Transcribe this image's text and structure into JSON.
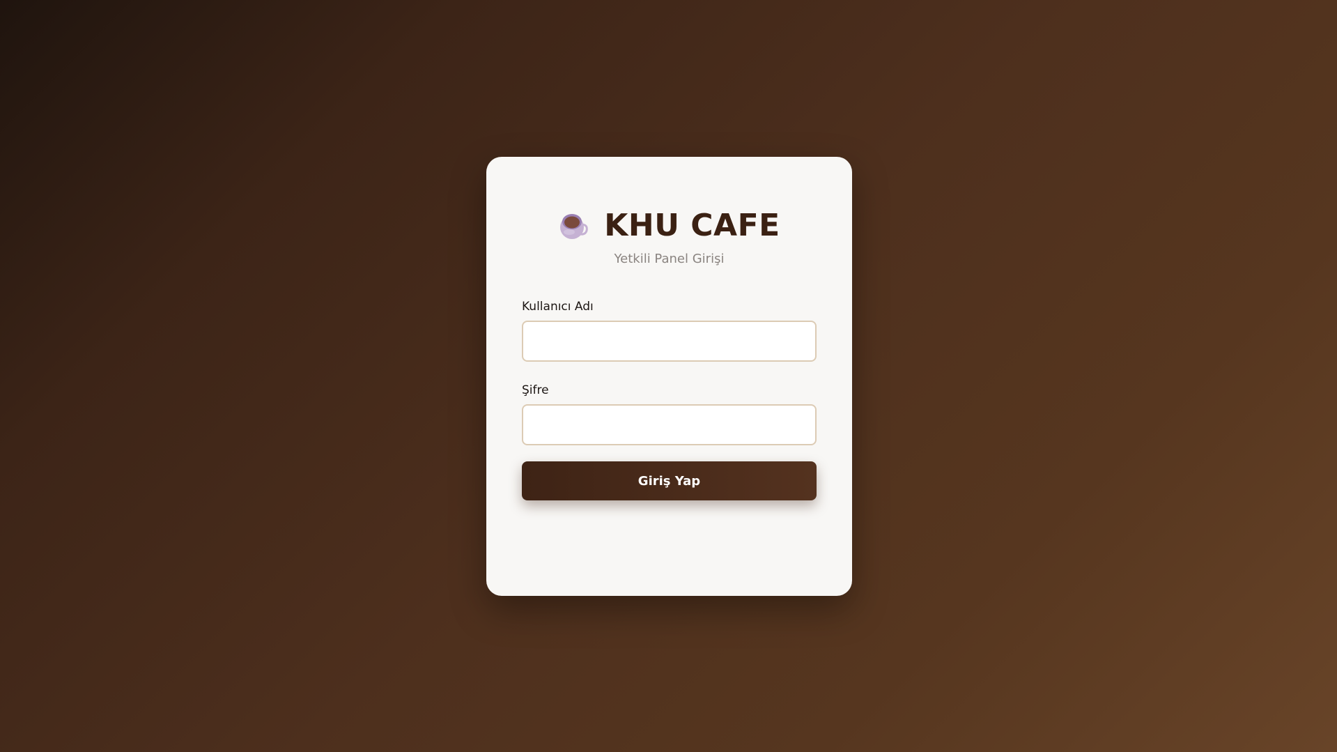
{
  "brand": {
    "icon": "coffee-cup-icon",
    "title": "KHU CAFE",
    "subtitle": "Yetkili Panel Girişi"
  },
  "form": {
    "username": {
      "label": "Kullanıcı Adı",
      "value": "",
      "placeholder": ""
    },
    "password": {
      "label": "Şifre",
      "value": "",
      "placeholder": ""
    },
    "submit_label": "Giriş Yap"
  },
  "colors": {
    "brand_text": "#3b2113",
    "button": "#4a2a1a",
    "input_border": "#dccbb4",
    "card_background": "#f8f7f5",
    "page_background_dark": "#1f140e",
    "page_background_light": "#684428"
  }
}
